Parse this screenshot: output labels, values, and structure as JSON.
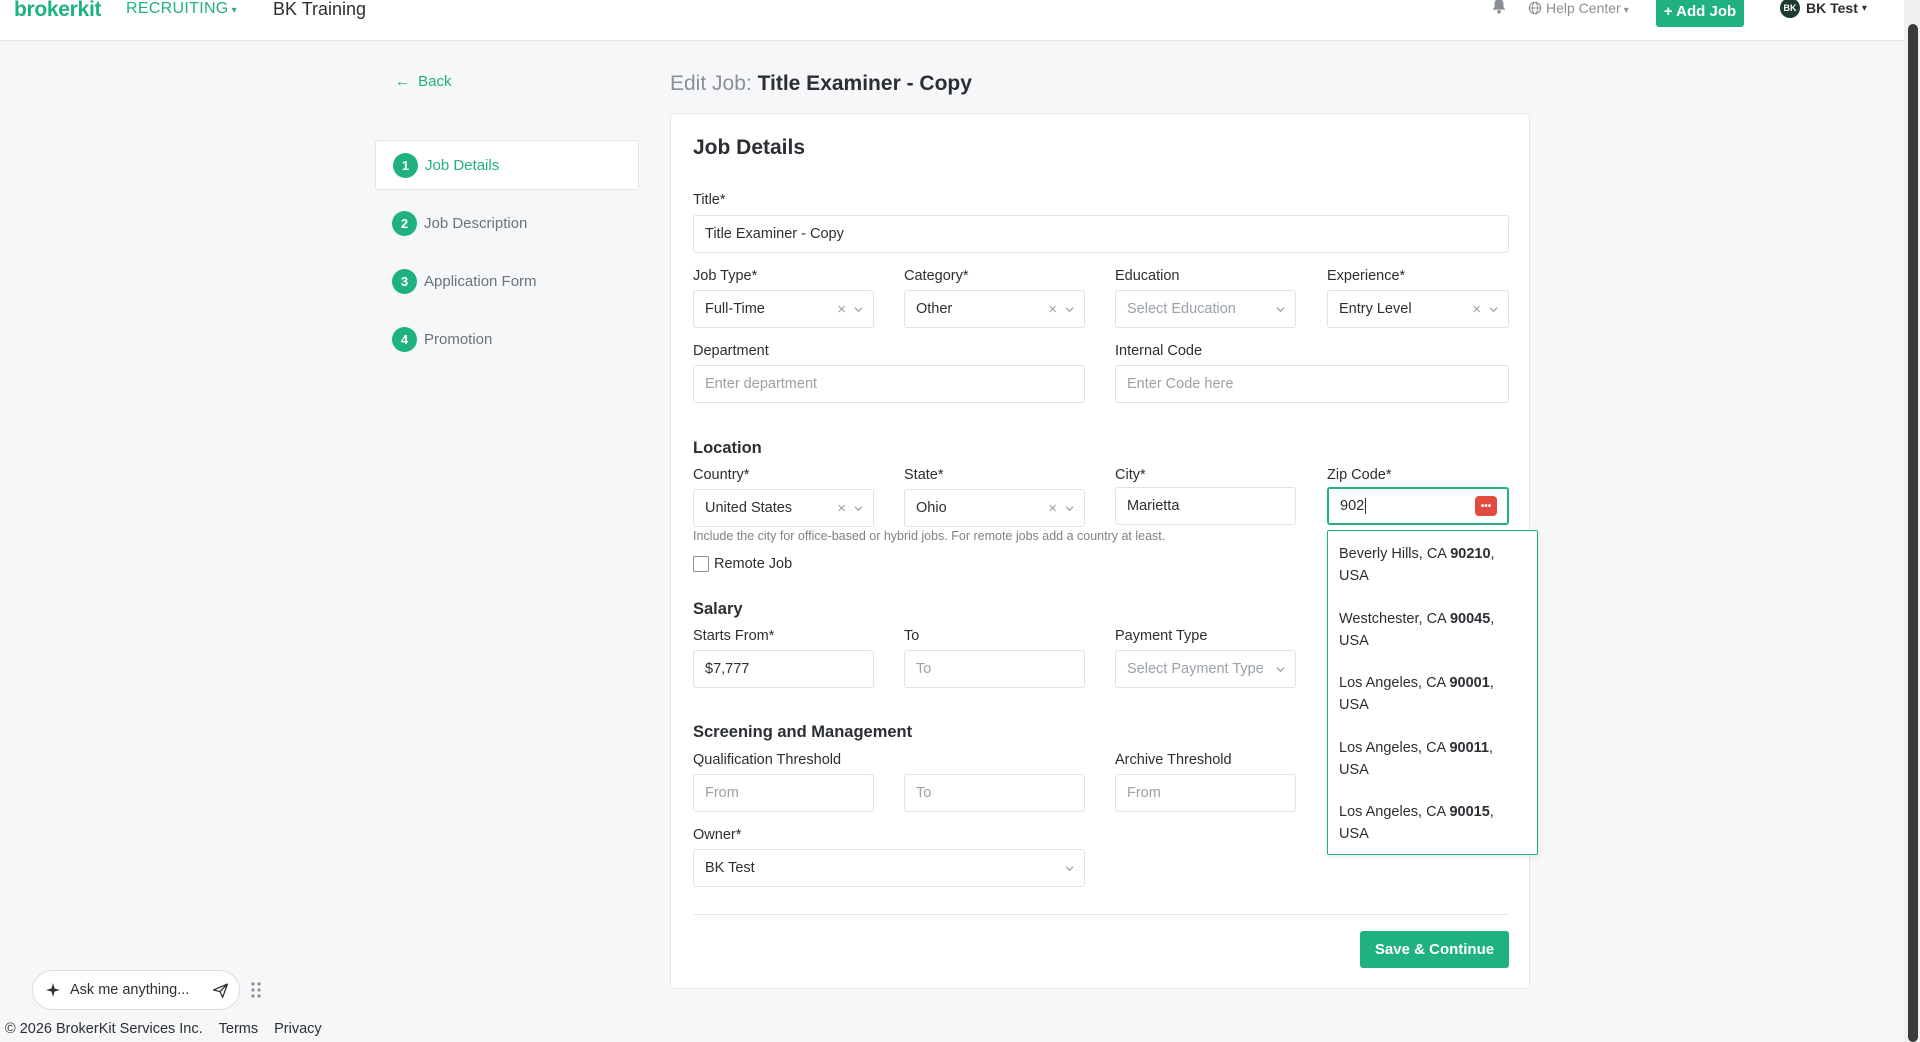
{
  "topnav": {
    "logo": "brokerkit",
    "product": "RECRUITING",
    "company": "BK Training",
    "help": "Help Center",
    "add_job": "+ Add Job",
    "user_initials": "BK",
    "user_name": "BK Test"
  },
  "sidebar": {
    "back": "Back",
    "steps": [
      {
        "num": "1",
        "label": "Job Details"
      },
      {
        "num": "2",
        "label": "Job Description"
      },
      {
        "num": "3",
        "label": "Application Form"
      },
      {
        "num": "4",
        "label": "Promotion"
      }
    ]
  },
  "page": {
    "title_prefix": "Edit Job:",
    "title_name": "Title Examiner - Copy"
  },
  "form": {
    "card_title": "Job Details",
    "title_label": "Title*",
    "title_value": "Title Examiner - Copy",
    "job_type_label": "Job Type*",
    "job_type_value": "Full-Time",
    "category_label": "Category*",
    "category_value": "Other",
    "education_label": "Education",
    "education_placeholder": "Select Education",
    "experience_label": "Experience*",
    "experience_value": "Entry Level",
    "department_label": "Department",
    "department_placeholder": "Enter department",
    "internal_code_label": "Internal Code",
    "internal_code_placeholder": "Enter Code here",
    "location_section": "Location",
    "country_label": "Country*",
    "country_value": "United States",
    "state_label": "State*",
    "state_value": "Ohio",
    "city_label": "City*",
    "city_value": "Marietta",
    "zip_label": "Zip Code*",
    "zip_value": "902",
    "location_hint": "Include the city for office-based or hybrid jobs. For remote jobs add a country at least.",
    "remote_label": "Remote Job",
    "remote_checked": false,
    "salary_section": "Salary",
    "starts_from_label": "Starts From*",
    "starts_from_value": "$7,777",
    "to_label": "To",
    "to_placeholder": "To",
    "payment_type_label": "Payment Type",
    "payment_type_placeholder": "Select Payment Type",
    "screening_section": "Screening and Management",
    "qual_threshold_label": "Qualification Threshold",
    "qual_from_placeholder": "From",
    "qual_to_placeholder": "To",
    "archive_threshold_label": "Archive Threshold",
    "archive_from_placeholder": "From",
    "owner_label": "Owner*",
    "owner_value": "BK Test",
    "save_button": "Save & Continue"
  },
  "zip_suggestions": [
    {
      "prefix": "Beverly Hills, CA ",
      "match": "90210",
      "suffix": ",",
      "line2": "USA"
    },
    {
      "prefix": "Westchester, CA ",
      "match": "90045",
      "suffix": ",",
      "line2": "USA"
    },
    {
      "prefix": "Los Angeles, CA ",
      "match": "90001",
      "suffix": ",",
      "line2": "USA"
    },
    {
      "prefix": "Los Angeles, CA ",
      "match": "90011",
      "suffix": ",",
      "line2": "USA"
    },
    {
      "prefix": "Los Angeles, CA ",
      "match": "90015",
      "suffix": ",",
      "line2": "USA"
    }
  ],
  "assistant": {
    "placeholder": "Ask me anything..."
  },
  "footer": {
    "copyright": "© 2026 BrokerKit Services Inc.",
    "terms": "Terms",
    "privacy": "Privacy"
  },
  "colors": {
    "brand": "#1fb17f",
    "zip_icon": "#e2493f"
  },
  "icons": [
    "bell-icon",
    "globe-icon",
    "back-arrow-icon",
    "clear-icon",
    "chevron-down-icon",
    "password-manager-icon",
    "sparkle-icon",
    "send-icon",
    "drag-grip-icon"
  ]
}
